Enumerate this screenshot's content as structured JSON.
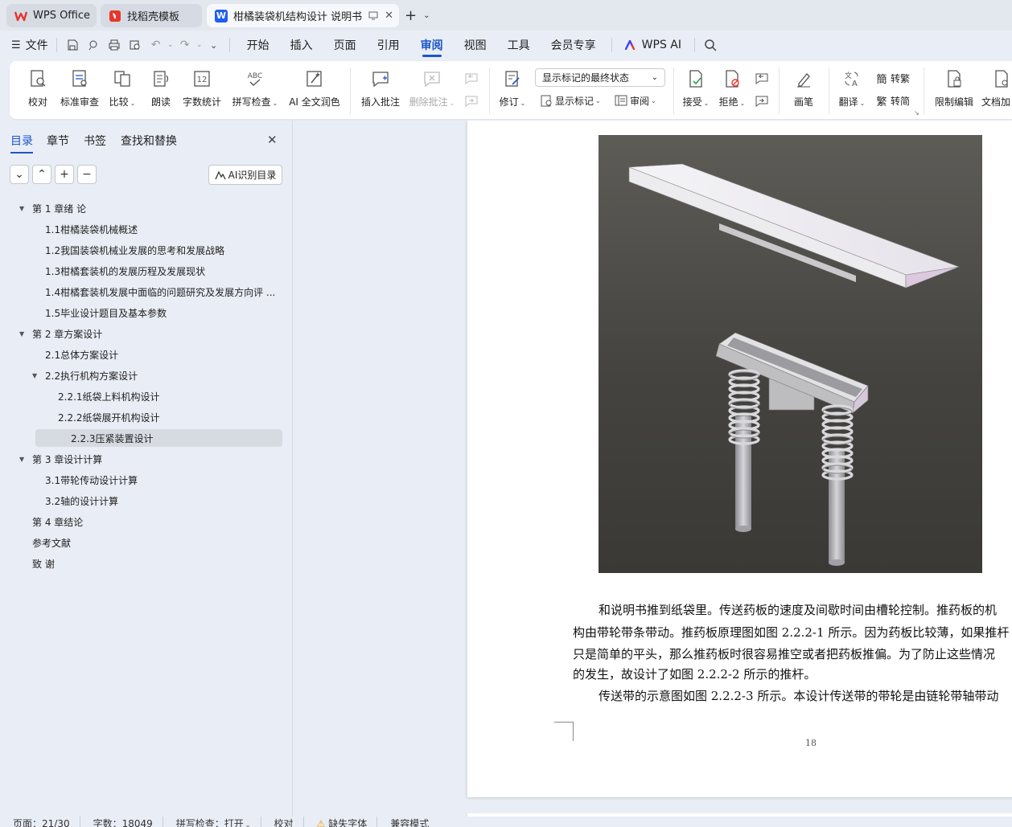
{
  "tabs": [
    {
      "label": "WPS Office"
    },
    {
      "label": "找稻壳模板"
    },
    {
      "label": "柑橘装袋机结构设计 说明书"
    }
  ],
  "menu": {
    "file": "文件",
    "items": [
      "开始",
      "插入",
      "页面",
      "引用",
      "审阅",
      "视图",
      "工具",
      "会员专享"
    ],
    "active": "审阅",
    "wps_ai": "WPS AI"
  },
  "ribbon": {
    "proofread": "校对",
    "standard_review": "标准审查",
    "compare": "比较",
    "read_aloud": "朗读",
    "word_count": "字数统计",
    "spell_check": "拼写检查",
    "ai_polish": "AI 全文润色",
    "insert_comment": "插入批注",
    "delete_comment": "删除批注",
    "track_changes": "修订",
    "markup_mode": "显示标记的最终状态",
    "show_markup": "显示标记",
    "review_pane": "审阅",
    "accept": "接受",
    "reject": "拒绝",
    "pen": "画笔",
    "translate": "翻译",
    "to_traditional": "转繁",
    "to_simplified": "转简",
    "restrict_editing": "限制编辑",
    "doc_auth": "文档加"
  },
  "nav": {
    "tabs": [
      "目录",
      "章节",
      "书签",
      "查找和替换"
    ],
    "ai_toc": "AI识别目录",
    "toc": [
      {
        "label": "第 1 章绪  论",
        "level": 1,
        "expanded": true
      },
      {
        "label": "1.1柑橘装袋机械概述",
        "level": 2
      },
      {
        "label": "1.2我国装袋机械业发展的思考和发展战略",
        "level": 2
      },
      {
        "label": "1.3柑橘套装机的发展历程及发展现状",
        "level": 2
      },
      {
        "label": "1.4柑橘套装机发展中面临的问题研究及发展方向评 ...",
        "level": 2
      },
      {
        "label": "1.5毕业设计题目及基本参数",
        "level": 2
      },
      {
        "label": "第 2 章方案设计",
        "level": 1,
        "expanded": true
      },
      {
        "label": "2.1总体方案设计",
        "level": 2
      },
      {
        "label": "2.2执行机构方案设计",
        "level": 2,
        "expanded": true
      },
      {
        "label": "2.2.1纸袋上料机构设计",
        "level": 3
      },
      {
        "label": "2.2.2纸袋展开机构设计",
        "level": 3
      },
      {
        "label": "2.2.3压紧装置设计",
        "level": 3,
        "selected": true
      },
      {
        "label": "第 3 章设计计算",
        "level": 1,
        "expanded": true
      },
      {
        "label": "3.1带轮传动设计计算",
        "level": 2
      },
      {
        "label": "3.2轴的设计计算",
        "level": 2
      },
      {
        "label": "第 4 章结论",
        "level": 1
      },
      {
        "label": "参考文献",
        "level": 1
      },
      {
        "label": "致  谢",
        "level": 1
      }
    ]
  },
  "document": {
    "lines": [
      "和说明书推到纸袋里。传送药板的速度及间歇时间由槽轮控制。推药板的机",
      "构由带轮带条带动。推药板原理图如图 2.2.2-1 所示。因为药板比较薄，如果推杆",
      "只是简单的平头，那么推药板时很容易推空或者把药板推偏。为了防止这些情况",
      "的发生，故设计了如图 2.2.2-2 所示的推杆。",
      "传送带的示意图如图 2.2.2-3 所示。本设计传送带的带轮是由链轮带轴带动"
    ],
    "page_number": "18"
  },
  "status": {
    "page": "页面：21/30",
    "words": "字数：18049",
    "spell": "拼写检查：打开",
    "proof": "校对",
    "missing_font": "缺失字体",
    "compat": "兼容模式"
  },
  "colors": {
    "accent": "#1c56c9",
    "wps_red": "#e8362b"
  }
}
